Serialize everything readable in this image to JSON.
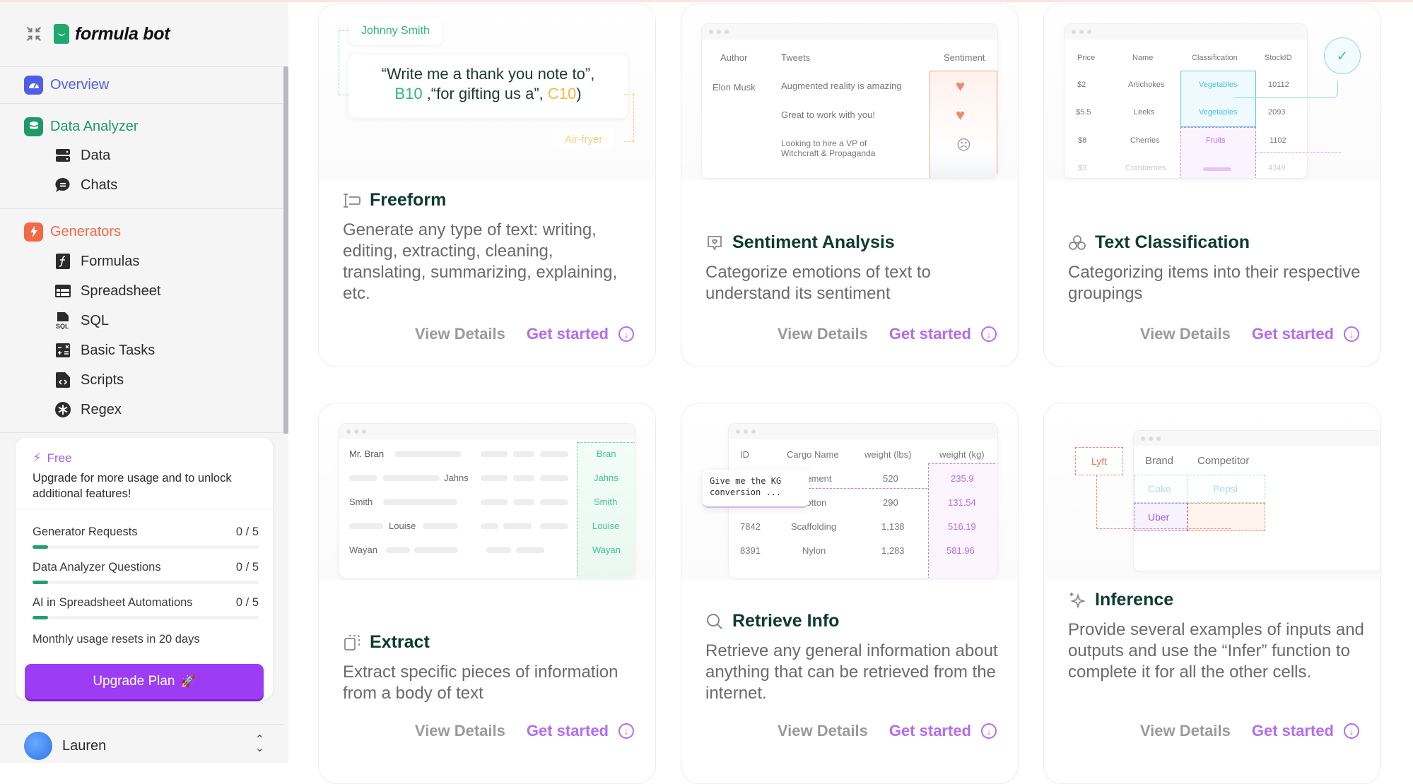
{
  "sidebar": {
    "brand": "formula bot",
    "sections": [
      {
        "label": "Overview",
        "color": "#4f5ee8",
        "icon": "gauge-icon"
      },
      {
        "label": "Data Analyzer",
        "color": "#1e9a6a",
        "icon": "database-icon",
        "items": [
          {
            "label": "Data",
            "icon": "server-icon"
          },
          {
            "label": "Chats",
            "icon": "chat-icon"
          }
        ]
      },
      {
        "label": "Generators",
        "color": "#f26a45",
        "icon": "bolt-icon",
        "items": [
          {
            "label": "Formulas",
            "icon": "function-icon"
          },
          {
            "label": "Spreadsheet",
            "icon": "table-icon"
          },
          {
            "label": "SQL",
            "icon": "sql-file-icon"
          },
          {
            "label": "Basic Tasks",
            "icon": "calculator-icon"
          },
          {
            "label": "Scripts",
            "icon": "code-file-icon"
          },
          {
            "label": "Regex",
            "icon": "asterisk-icon"
          }
        ]
      }
    ],
    "usage": {
      "plan": "Free",
      "description": "Upgrade for more usage and to unlock additional features!",
      "rows": [
        {
          "label": "Generator Requests",
          "count": "0 / 5",
          "fraction": 0
        },
        {
          "label": "Data Analyzer Questions",
          "count": "0 / 5",
          "fraction": 0
        },
        {
          "label": "AI in Spreadsheet Automations",
          "count": "0 / 5",
          "fraction": 0
        }
      ],
      "reset_text": "Monthly usage resets in 20 days",
      "upgrade_label": "Upgrade Plan"
    },
    "user": {
      "name": "Lauren"
    }
  },
  "cards": [
    {
      "title": "Freeform",
      "description": "Generate any type of text: writing, editing, extracting, cleaning, translating, summarizing, explaining, etc.",
      "view_label": "View Details",
      "start_label": "Get started",
      "preview": {
        "name_chip": "Johnny Smith",
        "prompt_line1": "“Write me a thank you note to”,",
        "prompt_ref1": "B10",
        "prompt_mid": " ,“for gifting us a”, ",
        "prompt_ref2": "C10",
        "prompt_end": ")",
        "item_chip": "Air-fryer"
      }
    },
    {
      "title": "Sentiment Analysis",
      "description": "Categorize emotions of text to understand its sentiment",
      "view_label": "View Details",
      "start_label": "Get started",
      "preview": {
        "headers": [
          "Author",
          "Tweets",
          "Sentiment"
        ],
        "author": "Elon Musk",
        "tweets": [
          "Augmented reality is amazing",
          "Great to work with you!",
          "Looking to hire a VP of Witchcraft & Propaganda"
        ],
        "sentiments": [
          "♥",
          "♥",
          "☹"
        ]
      }
    },
    {
      "title": "Text Classification",
      "description": "Categorizing items into their respective groupings",
      "view_label": "View Details",
      "start_label": "Get started",
      "preview": {
        "headers": [
          "Price",
          "Name",
          "Classification",
          "StockID"
        ],
        "rows": [
          [
            "$2",
            "Artichokes",
            "Vegetables",
            "10112"
          ],
          [
            "$5.5",
            "Leeks",
            "Vegetables",
            "2093"
          ],
          [
            "$8",
            "Cherries",
            "Fruits",
            "1102"
          ],
          [
            "$3",
            "Cranberries",
            "",
            "4349"
          ]
        ]
      }
    },
    {
      "title": "Extract",
      "description": "Extract specific pieces of information from a body of text",
      "view_label": "View Details",
      "start_label": "Get started",
      "preview": {
        "rows": [
          "Mr. Bran",
          "Jahns",
          "Smith",
          "Louise",
          "Wayan"
        ],
        "extracted": [
          "Bran",
          "Jahns",
          "Smith",
          "Louise",
          "Wayan"
        ]
      }
    },
    {
      "title": "Retrieve Info",
      "description": "Retrieve any general information about anything that can be retrieved from the internet.",
      "view_label": "View Details",
      "start_label": "Get started",
      "preview": {
        "headers": [
          "ID",
          "Cargo Name",
          "weight (lbs)",
          "weight (kg)"
        ],
        "rows": [
          [
            "",
            "Cement",
            "520",
            "235.9"
          ],
          [
            "",
            "Cotton",
            "290",
            "131.54"
          ],
          [
            "7842",
            "Scaffolding",
            "1,138",
            "516.19"
          ],
          [
            "8391",
            "Nylon",
            "1,283",
            "581.96"
          ]
        ],
        "prompt": "Give me the KG conversion ..."
      }
    },
    {
      "title": "Inference",
      "description": "Provide several examples of inputs and outputs and use the “Infer” function to complete it for all the other cells.",
      "view_label": "View Details",
      "start_label": "Get started",
      "preview": {
        "headers": [
          "Brand",
          "Competitor"
        ],
        "rows": [
          [
            "Coke",
            "Pepsi"
          ],
          [
            "Uber",
            ""
          ]
        ],
        "inferred": "Lyft"
      }
    }
  ]
}
